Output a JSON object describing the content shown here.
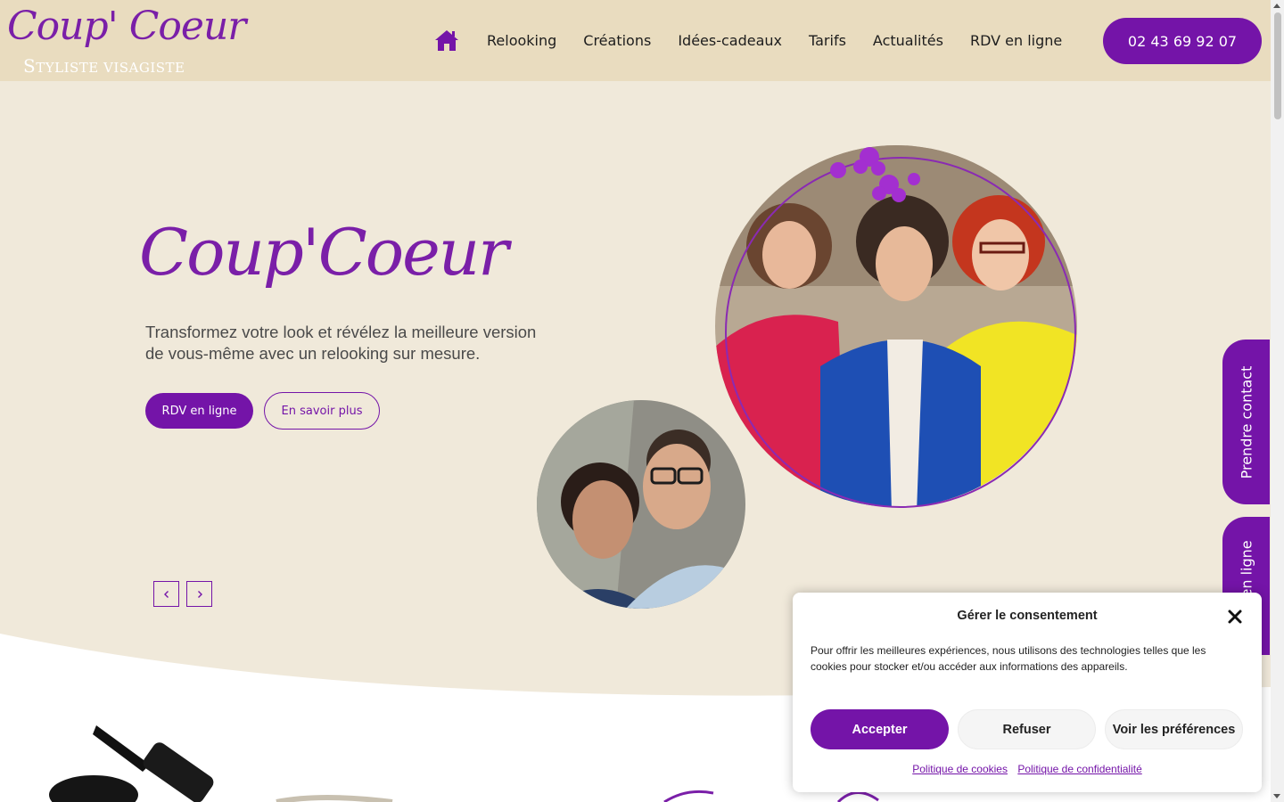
{
  "brand": {
    "logo_script": "Coup' Coeur",
    "logo_sub_first": "S",
    "logo_sub_rest": "TYLISTE VISAGISTE",
    "accent_color": "#7414a8",
    "header_bg": "#e9dcbf",
    "hero_bg": "#f0e9da"
  },
  "nav": {
    "home_icon": "home-icon",
    "items": [
      {
        "label": "Relooking"
      },
      {
        "label": "Créations"
      },
      {
        "label": "Idées-cadeaux"
      },
      {
        "label": "Tarifs"
      },
      {
        "label": "Actualités"
      },
      {
        "label": "RDV en ligne"
      }
    ],
    "phone": "02 43 69 92 07"
  },
  "hero": {
    "title": "Coup'Coeur",
    "tagline": "Transformez votre look et révélez la meilleure version de vous-même avec un relooking sur mesure.",
    "primary_btn": "RDV en ligne",
    "secondary_btn": "En savoir plus",
    "prev_icon": "chevron-left-icon",
    "next_icon": "chevron-right-icon"
  },
  "side_tabs": {
    "contact": "Prendre contact",
    "rdv": "RDV en ligne"
  },
  "cookie": {
    "title": "Gérer le consentement",
    "text": "Pour offrir les meilleures expériences, nous utilisons des technologies telles que les cookies pour stocker et/ou accéder aux informations des appareils.",
    "accept": "Accepter",
    "refuse": "Refuser",
    "preferences": "Voir les préférences",
    "link_cookies": "Politique de cookies",
    "link_privacy": "Politique de confidentialité"
  }
}
